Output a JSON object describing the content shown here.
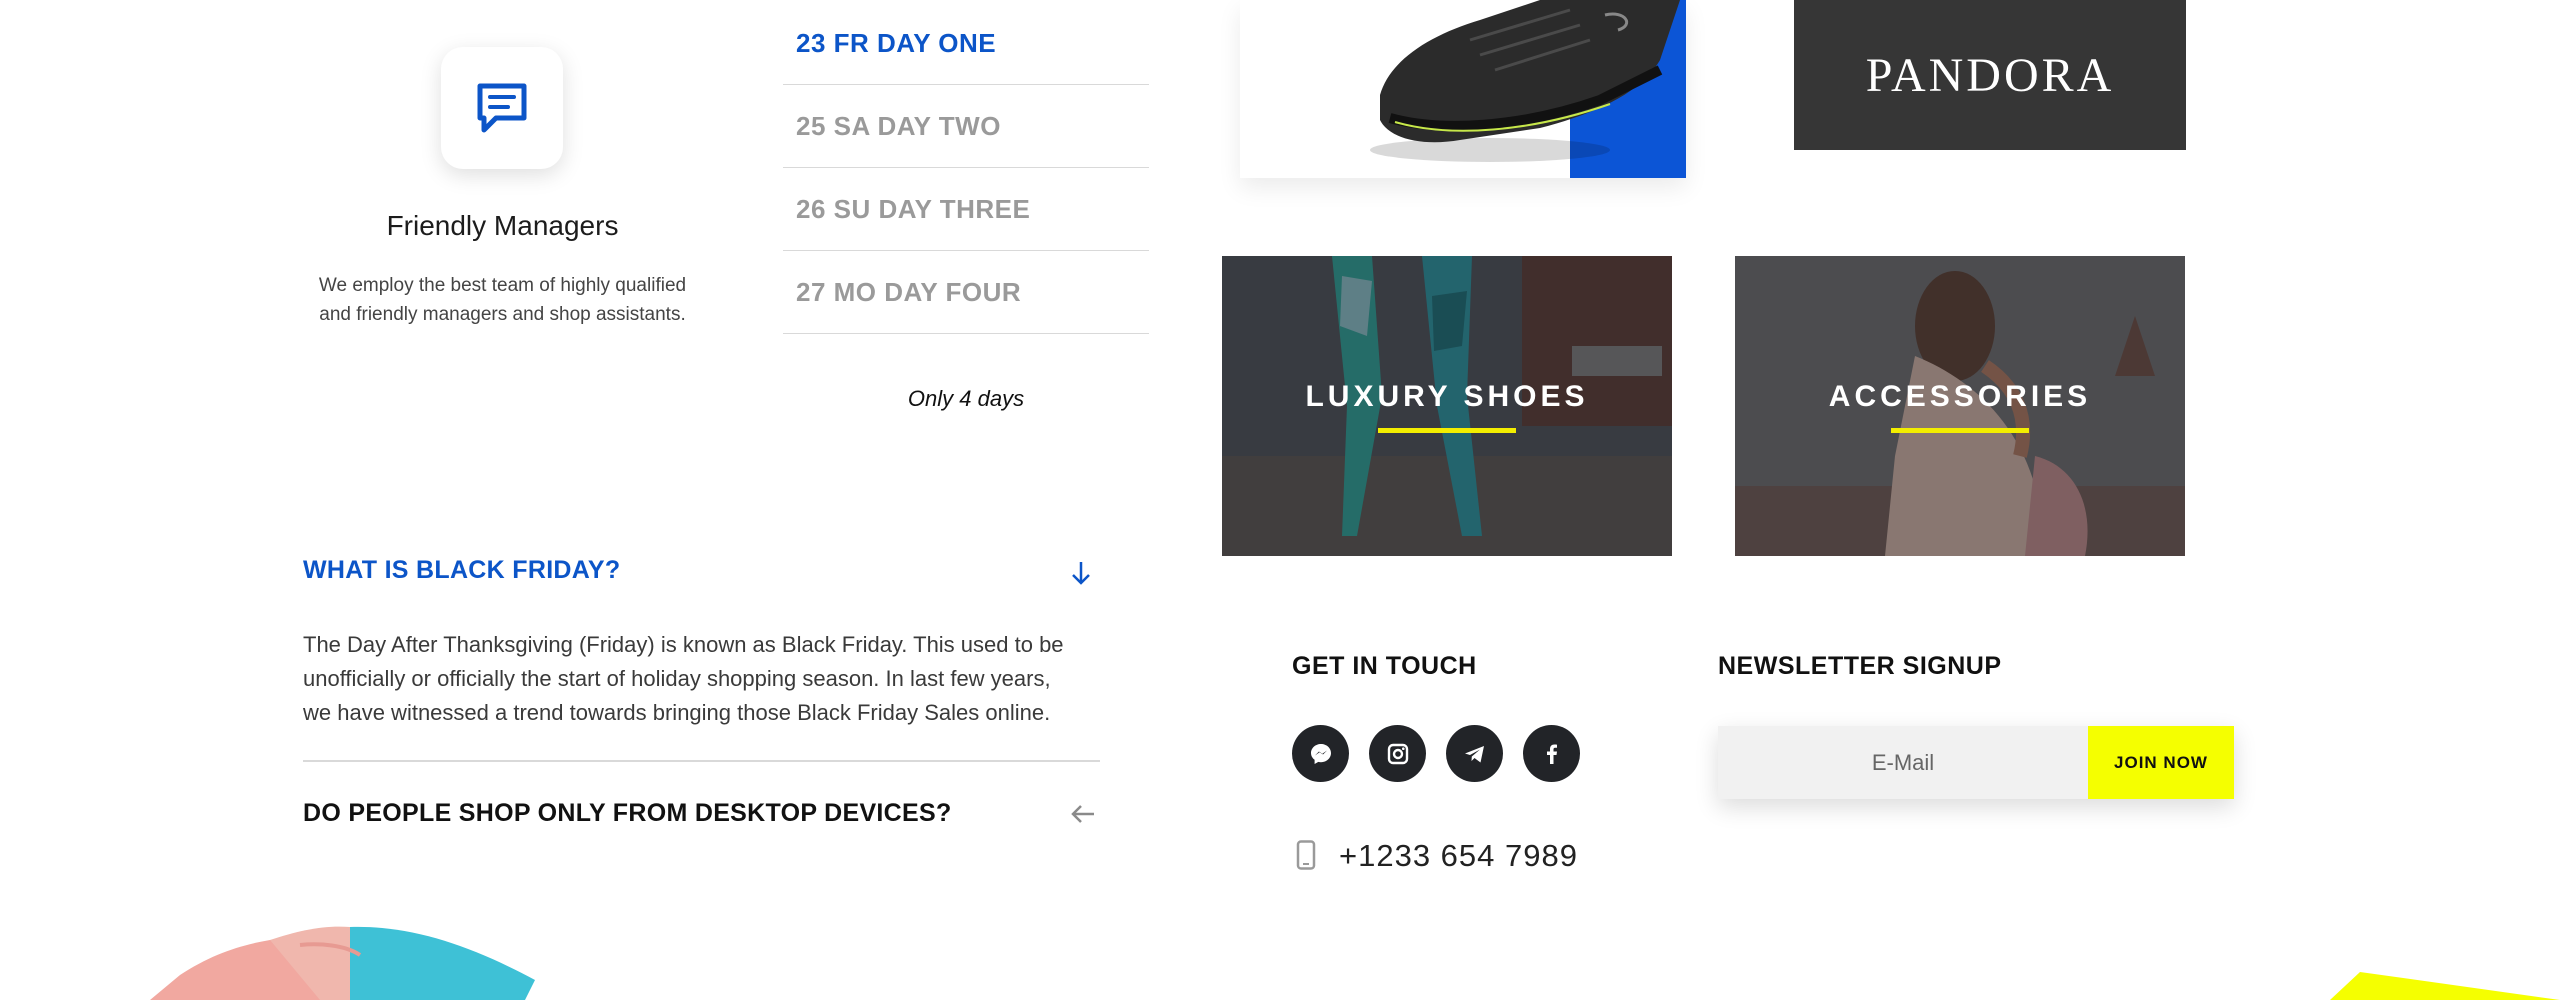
{
  "feature": {
    "icon": "chat-icon",
    "title": "Friendly Managers",
    "description_line1": "We employ the best team of highly qualified",
    "description_line2": "and friendly managers and shop assistants."
  },
  "days": {
    "tabs": [
      {
        "label": "23 FR DAY ONE",
        "active": true
      },
      {
        "label": "25 SA DAY TWO",
        "active": false
      },
      {
        "label": "26 SU DAY THREE",
        "active": false
      },
      {
        "label": "27 MO DAY FOUR",
        "active": false
      }
    ],
    "note": "Only 4 days"
  },
  "faq": {
    "items": [
      {
        "question": "WHAT IS BLACK FRIDAY?",
        "expanded": true,
        "answer_line1": "The Day After Thanksgiving (Friday) is known as Black Friday. This used to be",
        "answer_line2": "unofficially or officially the start of holiday shopping season. In last few years,",
        "answer_line3": "we have witnessed a trend towards bringing those Black Friday Sales online."
      },
      {
        "question": "DO PEOPLE SHOP ONLY FROM DESKTOP DEVICES?",
        "expanded": false
      }
    ]
  },
  "brands": {
    "pandora": "PANDORA"
  },
  "categories": [
    {
      "title": "LUXURY SHOES"
    },
    {
      "title": "ACCESSORIES"
    }
  ],
  "contact": {
    "title": "GET IN TOUCH",
    "socials": [
      "messenger-icon",
      "instagram-icon",
      "telegram-icon",
      "facebook-icon"
    ],
    "phone": "+1233 654 7989"
  },
  "newsletter": {
    "title": "NEWSLETTER SIGNUP",
    "placeholder": "E-Mail",
    "button": "JOIN NOW"
  },
  "colors": {
    "accent_blue": "#0c55c8",
    "accent_yellow": "#f5ff00",
    "dark": "#222428"
  }
}
